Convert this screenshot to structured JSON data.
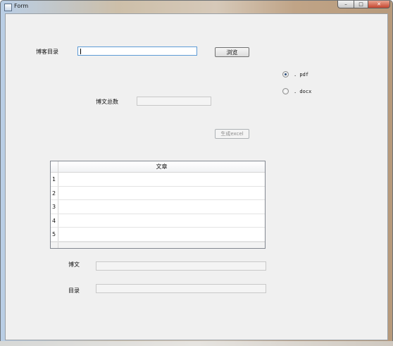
{
  "window": {
    "title": "Form",
    "controls": {
      "minimize": "–",
      "maximize": "□",
      "close": "✕"
    }
  },
  "form": {
    "blog_dir_label": "博客目录",
    "blog_dir_value": "",
    "browse_button": "浏览",
    "format_options": [
      {
        "label": ". pdf",
        "checked": true
      },
      {
        "label": ". docx",
        "checked": false
      }
    ],
    "post_count_label": "博文总数",
    "post_count_value": "",
    "generate_excel_button": "生成excel",
    "table": {
      "column_header": "文章",
      "row_numbers": [
        "1",
        "2",
        "3",
        "4",
        "5"
      ]
    },
    "post_label": "博文",
    "post_value": "",
    "toc_label": "目录",
    "toc_value": ""
  },
  "icons": {
    "app": "window-app-icon",
    "radio": "radio-icon"
  }
}
